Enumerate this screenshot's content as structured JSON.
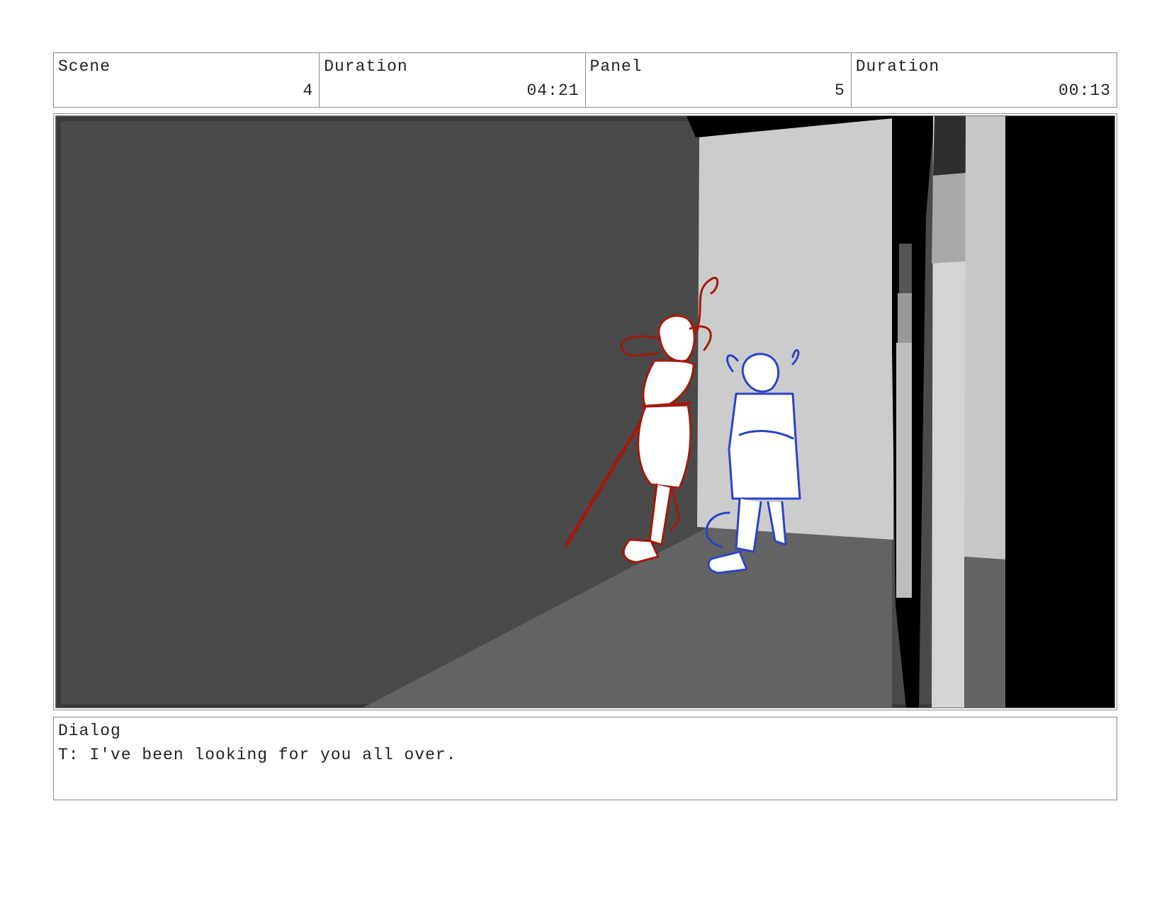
{
  "header": {
    "scene": {
      "label": "Scene",
      "value": "4"
    },
    "scene_duration": {
      "label": "Duration",
      "value": "04:21"
    },
    "panel": {
      "label": "Panel",
      "value": "5"
    },
    "panel_duration": {
      "label": "Duration",
      "value": "00:13"
    }
  },
  "dialog": {
    "label": "Dialog",
    "text": "T: I've been looking for you all over."
  },
  "colors": {
    "character_red": "#a31a0c",
    "character_blue": "#2a44c8",
    "wall_dark": "#4a4a4a",
    "floor": "#636363",
    "wall_light": "#cccccc"
  }
}
